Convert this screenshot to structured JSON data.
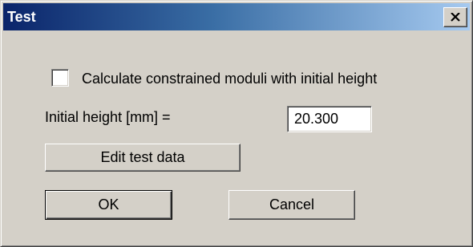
{
  "window": {
    "title": "Test",
    "close_icon": "close-icon"
  },
  "options": {
    "constrained_moduli_label": "Calculate constrained moduli with initial height",
    "constrained_moduli_checked": false
  },
  "initial_height": {
    "label": "Initial height [mm] =",
    "value": "20.300"
  },
  "buttons": {
    "edit_test_data": "Edit test data",
    "ok": "OK",
    "cancel": "Cancel"
  },
  "colors": {
    "titlebar_start": "#0a246a",
    "titlebar_end": "#a6caf0",
    "dialog_background": "#d4d0c8"
  }
}
